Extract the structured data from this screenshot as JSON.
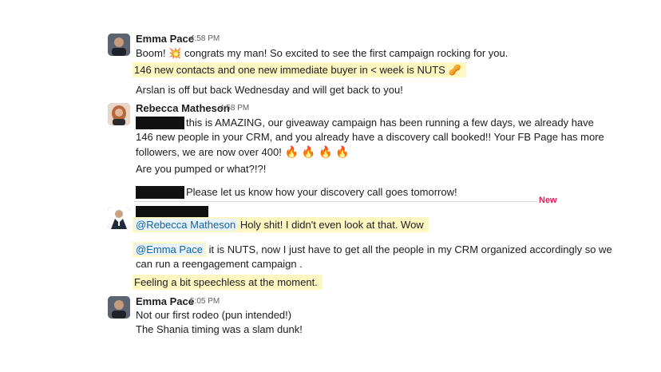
{
  "messages": [
    {
      "author": "Emma Pace",
      "time": "4:58 PM",
      "line1_pre": "Boom!",
      "line1_emoji": "💥",
      "line1_post": "congrats my man! So excited to see the first campaign rocking for you.",
      "line2": "146 new contacts and one new immediate buyer in < week is NUTS",
      "line2_emoji": "🥜",
      "line3": "Arslan is off but back Wednesday and will get back to you!"
    },
    {
      "author": "Rebecca Matheson",
      "time": "4:58 PM",
      "line1": "this is AMAZING, our giveaway campaign has been running a few days, we already have",
      "line2": "146 new people in your CRM, and you already have a discovery call booked!!  Your FB Page has more",
      "line3": "followers, we are now over 400!",
      "fire": "🔥 🔥 🔥 🔥",
      "line4": "Are you pumped or what?!?!",
      "line5": "Please let us know how your discovery call goes tomorrow!"
    },
    {
      "new_label": "New",
      "mention1": "@Rebecca Matheson",
      "line1": "Holy shit! I didn't even look at that. Wow",
      "mention2": "@Emma Pace",
      "line2": " it is NUTS, now I just have to get all the people in my CRM organized accordingly so we",
      "line3": "can run a reengagement campaign .",
      "line4": "Feeling a bit speechless at the moment."
    },
    {
      "author": "Emma Pace",
      "time": "5:05 PM",
      "line1": "Not our first rodeo (pun intended!)",
      "line2": "The Shania timing was a slam dunk!"
    }
  ],
  "colors": {
    "highlight": "#fff7c2",
    "mention": "#1264a3",
    "new_divider": "#e01e5a"
  }
}
